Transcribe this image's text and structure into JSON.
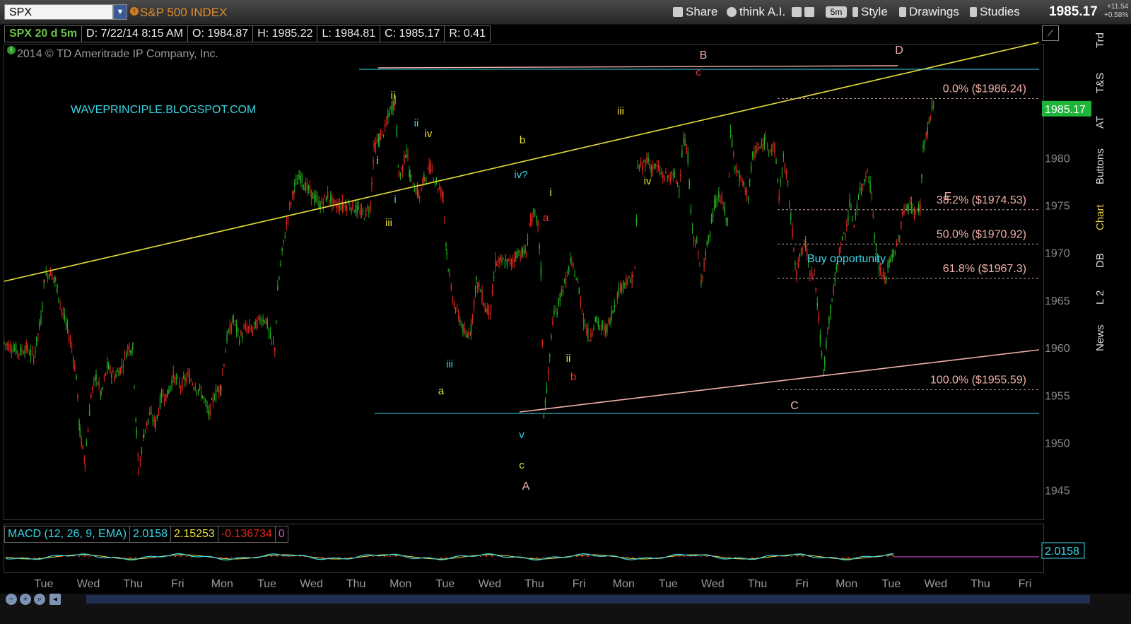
{
  "toolbar": {
    "symbol": "SPX",
    "description": "S&P 500 INDEX",
    "share": "Share",
    "think_ai": "think A.I.",
    "timeframe": "5m",
    "style": "Style",
    "drawings": "Drawings",
    "studies": "Studies",
    "last_price": "1985.17",
    "change": "+11.54",
    "change_pct": "+0.58%"
  },
  "info": {
    "symbol_period": "SPX 20 d 5m",
    "date": "D: 7/22/14 8:15 AM",
    "open": "O: 1984.87",
    "high": "H: 1985.22",
    "low": "L: 1984.81",
    "close": "C: 1985.17",
    "range": "R: 0.41"
  },
  "copyright": "2014 © TD Ameritrade IP Company, Inc.",
  "side_tabs": [
    "Trd",
    "T&S",
    "AT",
    "Buttons",
    "Chart",
    "DB",
    "L 2",
    "News"
  ],
  "macd": {
    "label": "MACD (12, 26, 9, EMA)",
    "value": "2.0158",
    "avg": "2.15253",
    "diff": "-0.136734",
    "zero": "0",
    "price_label": "2.0158"
  },
  "colors": {
    "up": "#22b21f",
    "down": "#e3261e",
    "trendline": "#e8e03a",
    "support": "#f2b0a8",
    "cyan": "#38d6e8",
    "fib": "#f2b0a8"
  },
  "chart_data": {
    "type": "candlestick",
    "title": "SPX 20 d 5m",
    "ylim": [
      1942,
      1992
    ],
    "yticks": [
      1945,
      1950,
      1955,
      1960,
      1965,
      1970,
      1975,
      1980
    ],
    "xticks": [
      "Tue",
      "Wed",
      "Thu",
      "Fri",
      "Mon",
      "Tue",
      "Wed",
      "Thu",
      "Mon",
      "Tue",
      "Wed",
      "Thu",
      "Fri",
      "Mon",
      "Tue",
      "Wed",
      "Thu",
      "Fri",
      "Mon",
      "Tue",
      "Wed",
      "Thu",
      "Fri"
    ],
    "price_path": [
      [
        0,
        1960.5
      ],
      [
        12,
        1960
      ],
      [
        20,
        1959.5
      ],
      [
        30,
        1960
      ],
      [
        40,
        1959
      ],
      [
        50,
        1963
      ],
      [
        55,
        1967.5
      ],
      [
        63,
        1968
      ],
      [
        70,
        1967
      ],
      [
        78,
        1964
      ],
      [
        86,
        1962
      ],
      [
        92,
        1960
      ],
      [
        98,
        1957
      ],
      [
        103,
        1951
      ],
      [
        110,
        1948
      ],
      [
        118,
        1955
      ],
      [
        125,
        1957
      ],
      [
        132,
        1955
      ],
      [
        140,
        1958
      ],
      [
        150,
        1957
      ],
      [
        160,
        1958
      ],
      [
        168,
        1960
      ],
      [
        175,
        1960
      ],
      [
        180,
        1951
      ],
      [
        183,
        1947
      ],
      [
        190,
        1951
      ],
      [
        198,
        1953
      ],
      [
        206,
        1952
      ],
      [
        214,
        1955
      ],
      [
        222,
        1955
      ],
      [
        230,
        1957
      ],
      [
        240,
        1956
      ],
      [
        250,
        1957
      ],
      [
        260,
        1956
      ],
      [
        270,
        1955
      ],
      [
        278,
        1953
      ],
      [
        286,
        1955
      ],
      [
        295,
        1956
      ],
      [
        303,
        1961
      ],
      [
        312,
        1963
      ],
      [
        320,
        1961
      ],
      [
        328,
        1962
      ],
      [
        338,
        1962
      ],
      [
        348,
        1963
      ],
      [
        356,
        1963
      ],
      [
        362,
        1961
      ],
      [
        368,
        1960
      ],
      [
        372,
        1966
      ],
      [
        378,
        1970
      ],
      [
        386,
        1974
      ],
      [
        395,
        1977
      ],
      [
        403,
        1978
      ],
      [
        410,
        1977
      ],
      [
        420,
        1976
      ],
      [
        430,
        1975
      ],
      [
        440,
        1976
      ],
      [
        450,
        1975
      ],
      [
        460,
        1975
      ],
      [
        470,
        1975
      ],
      [
        480,
        1974.5
      ],
      [
        490,
        1974
      ],
      [
        498,
        1975
      ],
      [
        503,
        1981
      ],
      [
        510,
        1982
      ],
      [
        518,
        1983
      ],
      [
        525,
        1985
      ],
      [
        532,
        1986
      ],
      [
        537,
        1978
      ],
      [
        542,
        1979
      ],
      [
        547,
        1981
      ],
      [
        552,
        1978
      ],
      [
        558,
        1977
      ],
      [
        565,
        1976
      ],
      [
        572,
        1978
      ],
      [
        580,
        1979
      ],
      [
        590,
        1977
      ],
      [
        597,
        1976
      ],
      [
        602,
        1970
      ],
      [
        608,
        1966
      ],
      [
        614,
        1964
      ],
      [
        620,
        1963
      ],
      [
        628,
        1961
      ],
      [
        635,
        1962
      ],
      [
        642,
        1967
      ],
      [
        648,
        1966
      ],
      [
        655,
        1964
      ],
      [
        662,
        1964
      ],
      [
        668,
        1969
      ],
      [
        675,
        1969
      ],
      [
        682,
        1969
      ],
      [
        690,
        1969
      ],
      [
        698,
        1970
      ],
      [
        705,
        1970
      ],
      [
        710,
        1970
      ],
      [
        714,
        1973
      ],
      [
        720,
        1974
      ],
      [
        726,
        1973
      ],
      [
        730,
        1968
      ],
      [
        734,
        1953
      ],
      [
        740,
        1957
      ],
      [
        746,
        1963
      ],
      [
        752,
        1964
      ],
      [
        758,
        1966
      ],
      [
        764,
        1967
      ],
      [
        770,
        1969
      ],
      [
        776,
        1968
      ],
      [
        782,
        1966
      ],
      [
        788,
        1963
      ],
      [
        796,
        1961
      ],
      [
        804,
        1963
      ],
      [
        812,
        1962
      ],
      [
        820,
        1962
      ],
      [
        828,
        1964
      ],
      [
        836,
        1966
      ],
      [
        844,
        1967
      ],
      [
        852,
        1967
      ],
      [
        858,
        1968
      ],
      [
        862,
        1979
      ],
      [
        868,
        1979
      ],
      [
        874,
        1980
      ],
      [
        880,
        1979
      ],
      [
        888,
        1979
      ],
      [
        896,
        1978
      ],
      [
        904,
        1978
      ],
      [
        912,
        1978
      ],
      [
        918,
        1977
      ],
      [
        924,
        1982
      ],
      [
        930,
        1980
      ],
      [
        936,
        1972
      ],
      [
        942,
        1971
      ],
      [
        948,
        1967
      ],
      [
        954,
        1970
      ],
      [
        960,
        1972
      ],
      [
        966,
        1975
      ],
      [
        972,
        1976
      ],
      [
        978,
        1975
      ],
      [
        984,
        1973
      ],
      [
        988,
        1983
      ],
      [
        994,
        1979
      ],
      [
        1000,
        1978
      ],
      [
        1006,
        1977
      ],
      [
        1012,
        1976
      ],
      [
        1018,
        1980
      ],
      [
        1024,
        1981
      ],
      [
        1030,
        1981
      ],
      [
        1036,
        1982
      ],
      [
        1042,
        1981
      ],
      [
        1048,
        1981
      ],
      [
        1054,
        1976
      ],
      [
        1060,
        1980
      ],
      [
        1066,
        1977
      ],
      [
        1072,
        1972
      ],
      [
        1078,
        1968
      ],
      [
        1084,
        1970
      ],
      [
        1090,
        1971
      ],
      [
        1096,
        1968
      ],
      [
        1102,
        1968
      ],
      [
        1108,
        1963
      ],
      [
        1114,
        1957
      ],
      [
        1120,
        1962
      ],
      [
        1126,
        1965
      ],
      [
        1132,
        1968
      ],
      [
        1138,
        1971
      ],
      [
        1144,
        1972
      ],
      [
        1150,
        1975
      ],
      [
        1156,
        1973
      ],
      [
        1162,
        1976
      ],
      [
        1168,
        1977
      ],
      [
        1174,
        1979
      ],
      [
        1180,
        1976
      ],
      [
        1186,
        1970
      ],
      [
        1192,
        1968
      ],
      [
        1198,
        1967
      ],
      [
        1204,
        1969
      ],
      [
        1210,
        1970
      ],
      [
        1216,
        1971
      ],
      [
        1222,
        1974
      ],
      [
        1228,
        1975
      ],
      [
        1234,
        1975
      ],
      [
        1240,
        1974
      ],
      [
        1246,
        1975
      ],
      [
        1250,
        1981
      ],
      [
        1256,
        1983
      ],
      [
        1262,
        1985
      ],
      [
        1266,
        1986
      ]
    ],
    "price_path_x": "bar index (each index = one 5-minute bar segment across the chart)",
    "last": 1985.17,
    "fib_levels": [
      {
        "label": "0.0%",
        "value": "($1986.24)",
        "price": 1986.24
      },
      {
        "label": "38.2%",
        "value": "($1974.53)",
        "price": 1974.53
      },
      {
        "label": "50.0%",
        "value": "($1970.92)",
        "price": 1970.92
      },
      {
        "label": "61.8%",
        "value": "($1967.3)",
        "price": 1967.3
      },
      {
        "label": "100.0%",
        "value": "($1955.59)",
        "price": 1955.59
      }
    ],
    "annotations": [
      {
        "text": "WAVEPRINCIPLE.BLOGSPOT.COM",
        "color": "cyan"
      },
      {
        "text": "Buy opportunity",
        "color": "cyan"
      },
      {
        "text": "i",
        "color": "yellow"
      },
      {
        "text": "ii",
        "color": "yellow"
      },
      {
        "text": "iii",
        "color": "yellow"
      },
      {
        "text": "iv",
        "color": "yellow"
      },
      {
        "text": "i",
        "color": "cyan"
      },
      {
        "text": "ii",
        "color": "cyan"
      },
      {
        "text": "iii",
        "color": "cyan"
      },
      {
        "text": "iv?",
        "color": "cyan"
      },
      {
        "text": "v",
        "color": "cyan"
      },
      {
        "text": "a",
        "color": "yellow"
      },
      {
        "text": "b",
        "color": "yellow"
      },
      {
        "text": "c",
        "color": "yellow"
      },
      {
        "text": "A",
        "color": "pink"
      },
      {
        "text": "i",
        "color": "yellow"
      },
      {
        "text": "ii",
        "color": "yellow"
      },
      {
        "text": "a",
        "color": "red"
      },
      {
        "text": "b",
        "color": "red"
      },
      {
        "text": "c",
        "color": "red"
      },
      {
        "text": "iii",
        "color": "yellow"
      },
      {
        "text": "iv",
        "color": "yellow"
      },
      {
        "text": "B",
        "color": "pink"
      },
      {
        "text": "C",
        "color": "pink"
      },
      {
        "text": "D",
        "color": "pink"
      },
      {
        "text": "E",
        "color": "pink"
      }
    ]
  }
}
